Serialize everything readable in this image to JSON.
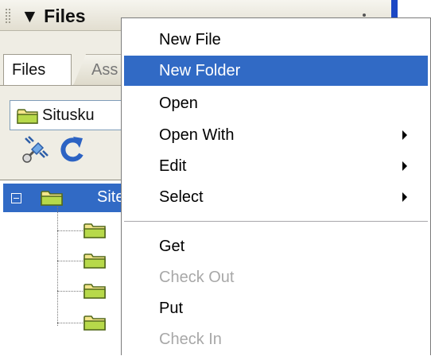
{
  "panel": {
    "title": "Files",
    "tabs": [
      {
        "label": "Files"
      },
      {
        "label": "Ass"
      }
    ],
    "site_dropdown": {
      "value": "Situsku"
    },
    "tree": {
      "root_label": "Site"
    }
  },
  "context_menu": {
    "items": [
      {
        "label": "New File"
      },
      {
        "label": "New Folder"
      },
      {
        "label": "Open"
      },
      {
        "label": "Open With"
      },
      {
        "label": "Edit"
      },
      {
        "label": "Select"
      },
      {
        "label": "Get"
      },
      {
        "label": "Check Out"
      },
      {
        "label": "Put"
      },
      {
        "label": "Check In"
      }
    ]
  },
  "icons": {
    "folder": "folder-icon",
    "connect": "connect-icon",
    "refresh": "refresh-icon",
    "collapse": "collapse-icon",
    "submenu": "triangle-right-icon"
  },
  "colors": {
    "highlight": "#316ac5",
    "folder": "#b7d94a",
    "disabled_text": "#a8a8a8"
  }
}
